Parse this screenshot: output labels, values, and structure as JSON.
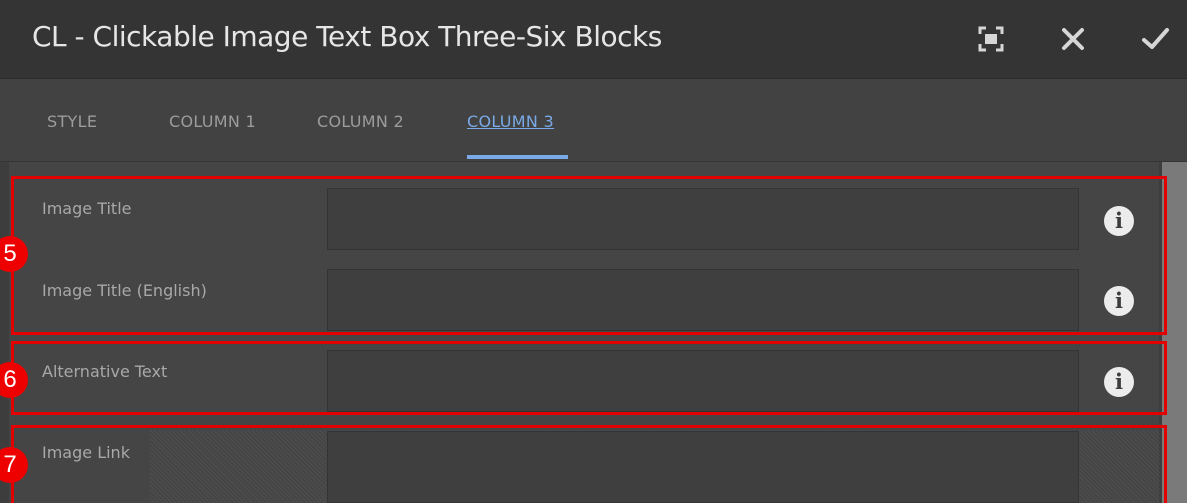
{
  "dialog": {
    "title": "CL - Clickable Image Text Box Three-Six Blocks",
    "buttons": {
      "fullscreen_icon": "fullscreen-icon",
      "close_icon": "close-icon",
      "confirm_icon": "check-icon"
    }
  },
  "tabs": [
    {
      "label": "STYLE",
      "active": false
    },
    {
      "label": "COLUMN 1",
      "active": false
    },
    {
      "label": "COLUMN 2",
      "active": false
    },
    {
      "label": "COLUMN 3",
      "active": true
    }
  ],
  "fields": [
    {
      "label": "Image Title",
      "value": "",
      "info": "i"
    },
    {
      "label": "Image Title (English)",
      "value": "",
      "info": "i"
    },
    {
      "label": "Alternative Text",
      "value": "",
      "info": "i"
    },
    {
      "label": "Image Link",
      "value": ""
    }
  ],
  "annotations": [
    {
      "number": "5"
    },
    {
      "number": "6"
    },
    {
      "number": "7"
    }
  ],
  "colors": {
    "accent": "#79a9e6",
    "highlight": "#e20000",
    "titlebar": "#343434",
    "panel": "#454545"
  }
}
